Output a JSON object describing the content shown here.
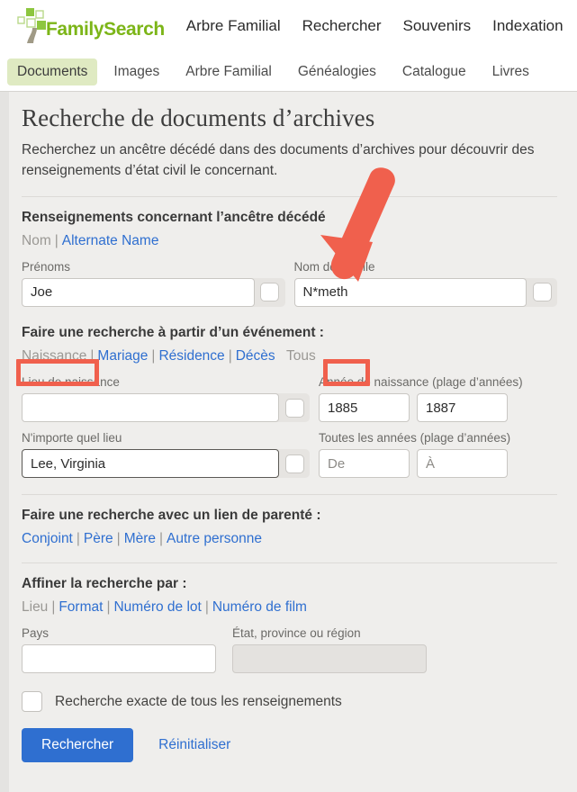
{
  "header": {
    "brand": "FamilySearch",
    "nav": [
      {
        "label": "Arbre Familial"
      },
      {
        "label": "Rechercher"
      },
      {
        "label": "Souvenirs"
      },
      {
        "label": "Indexation"
      }
    ]
  },
  "tabs": [
    {
      "label": "Documents",
      "active": true
    },
    {
      "label": "Images",
      "active": false
    },
    {
      "label": "Arbre Familial",
      "active": false
    },
    {
      "label": "Généalogies",
      "active": false
    },
    {
      "label": "Catalogue",
      "active": false
    },
    {
      "label": "Livres",
      "active": false
    }
  ],
  "page": {
    "title": "Recherche de documents d’archives",
    "intro": "Recherchez un ancêtre décédé dans des documents d’archives pour découvrir des renseignements d’état civil le concernant."
  },
  "ancestor": {
    "heading": "Renseignements concernant l’ancêtre décédé",
    "links": [
      {
        "label": "Nom",
        "selected": true
      },
      {
        "label": "Alternate Name",
        "selected": false
      }
    ],
    "given_label": "Prénoms",
    "given_value": "Joe",
    "surname_label": "Nom de famille",
    "surname_value": "N*meth"
  },
  "event": {
    "heading": "Faire une recherche à partir d’un événement :",
    "links": [
      {
        "label": "Naissance",
        "selected": true
      },
      {
        "label": "Mariage",
        "selected": false
      },
      {
        "label": "Résidence",
        "selected": false
      },
      {
        "label": "Décès",
        "selected": false
      },
      {
        "label": "Tous",
        "selected": true
      }
    ],
    "birthplace_label": "Lieu de naissance",
    "birthplace_value": "",
    "birthyear_label": "Année de naissance (plage d’années)",
    "birthyear_from": "1885",
    "birthyear_to": "1887",
    "anyplace_label": "N'importe quel lieu",
    "anyplace_value": "Lee, Virginia",
    "anyyear_label": "Toutes les années (plage d’années)",
    "anyyear_from_placeholder": "De",
    "anyyear_to_placeholder": "À"
  },
  "relationship": {
    "heading": "Faire une recherche avec un lien de parenté :",
    "links": [
      {
        "label": "Conjoint",
        "selected": false
      },
      {
        "label": "Père",
        "selected": false
      },
      {
        "label": "Mère",
        "selected": false
      },
      {
        "label": "Autre personne",
        "selected": false
      }
    ]
  },
  "refine": {
    "heading": "Affiner la recherche par :",
    "links": [
      {
        "label": "Lieu",
        "selected": true
      },
      {
        "label": "Format",
        "selected": false
      },
      {
        "label": "Numéro de lot",
        "selected": false
      },
      {
        "label": "Numéro de film",
        "selected": false
      }
    ],
    "country_label": "Pays",
    "country_value": "",
    "state_label": "État, province ou région",
    "state_value": ""
  },
  "footer": {
    "exact_label": "Recherche exacte de tous les renseignements",
    "exact_checked": false,
    "search_button": "Rechercher",
    "reset_link": "Réinitialiser"
  },
  "annotations": {
    "arrow": "red-down-left-arrow-pointing-to-surname-field",
    "box_naissance": "red-rectangle-around-naissance-link",
    "box_tous": "red-rectangle-around-tous-link"
  },
  "colors": {
    "brand_green": "#7cb518",
    "link_blue": "#2f6fd0",
    "tab_active_bg": "#dfeac2",
    "annotation_red": "#f0604d",
    "page_bg": "#efeeec"
  }
}
